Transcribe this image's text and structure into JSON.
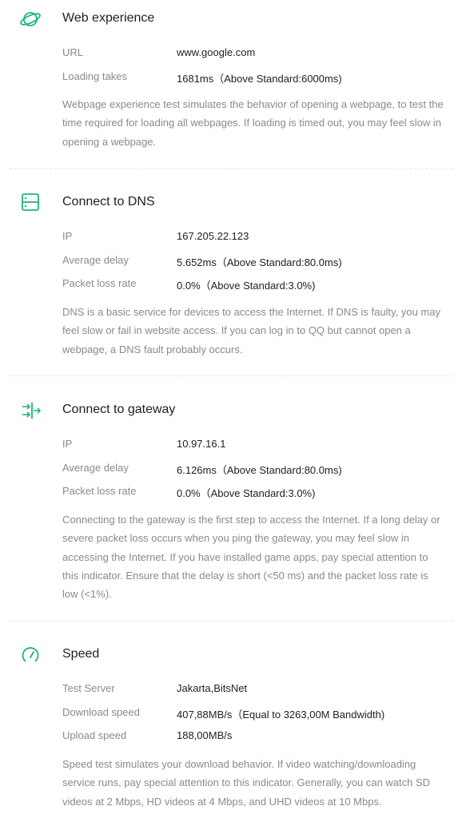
{
  "theme": {
    "accent": "#1fb57a",
    "label_color": "#8a8a8a",
    "text_color": "#222222"
  },
  "web": {
    "icon": "planet-icon",
    "title": "Web experience",
    "rows": [
      {
        "label": "URL",
        "value": "www.google.com"
      },
      {
        "label": "Loading takes",
        "value": "1681ms（Above Standard:6000ms)"
      }
    ],
    "description": "Webpage experience test simulates the behavior of opening a webpage, to test the time required for loading all webpages. If loading is timed out, you may feel slow in opening a webpage."
  },
  "dns": {
    "icon": "server-icon",
    "title": "Connect to DNS",
    "rows": [
      {
        "label": "IP",
        "value": "167.205.22.123"
      },
      {
        "label": "Average delay",
        "value": "5.652ms（Above Standard:80.0ms)"
      },
      {
        "label": "Packet loss rate",
        "value": "0.0%（Above Standard:3.0%)"
      }
    ],
    "description": "DNS is a basic service for devices to access the Internet. If DNS is faulty, you may feel slow or fail in website access. If you can log in to QQ but cannot open a webpage, a DNS fault probably occurs."
  },
  "gateway": {
    "icon": "gateway-arrows-icon",
    "title": "Connect to gateway",
    "rows": [
      {
        "label": "IP",
        "value": "10.97.16.1"
      },
      {
        "label": "Average delay",
        "value": "6.126ms（Above Standard:80.0ms)"
      },
      {
        "label": "Packet loss rate",
        "value": "0.0%（Above Standard:3.0%)"
      }
    ],
    "description": "Connecting to the gateway is the first step to access the Internet. If a long delay or severe packet loss occurs when you ping the gateway, you may feel slow in accessing the Internet. If you have installed game apps, pay special attention to this indicator. Ensure that the delay is short (<50 ms) and the packet loss rate is low (<1%)."
  },
  "speed": {
    "icon": "speedometer-icon",
    "title": "Speed",
    "rows": [
      {
        "label": "Test Server",
        "value": "Jakarta,BitsNet"
      },
      {
        "label": "Download speed",
        "value": "407,88MB/s（Equal to 3263,00M Bandwidth)"
      },
      {
        "label": "Upload speed",
        "value": "188,00MB/s"
      }
    ],
    "description": "Speed test simulates your download behavior. If video watching/downloading service runs, pay special attention to this indicator. Generally, you can watch SD videos at 2 Mbps, HD videos at 4 Mbps, and UHD videos at 10 Mbps."
  }
}
